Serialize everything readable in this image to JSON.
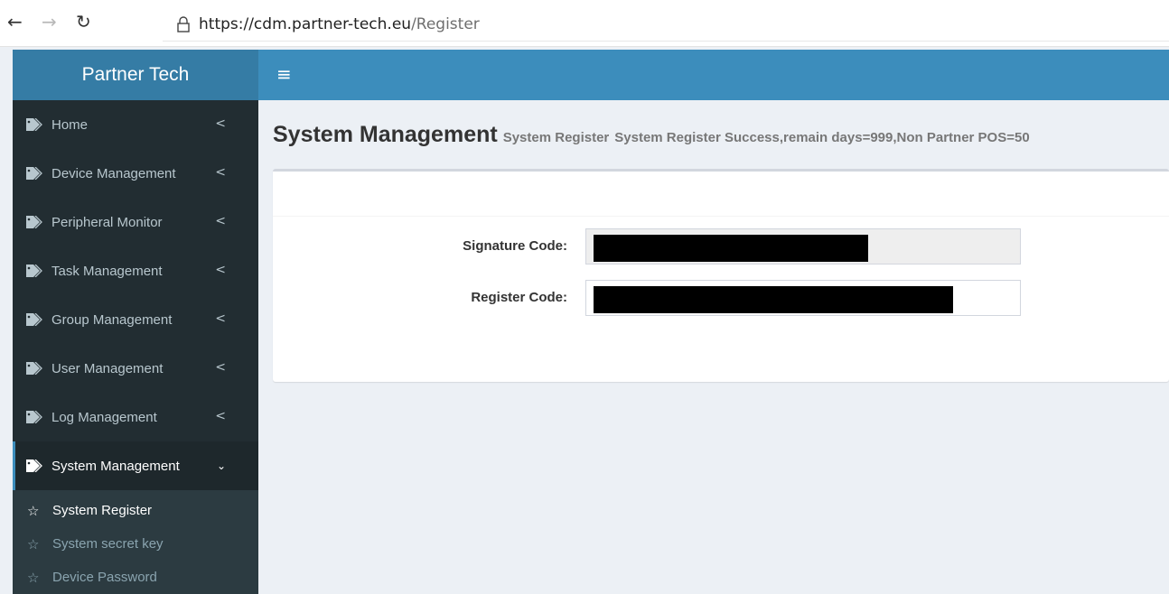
{
  "browser": {
    "url_host": "https://cdm.partner-tech.eu",
    "url_path": "/Register",
    "back_icon": "←",
    "forward_icon": "→",
    "reload_icon": "↻"
  },
  "header": {
    "logo": "Partner Tech",
    "toggle_icon": "≡"
  },
  "sidebar": {
    "items": [
      {
        "label": "Home",
        "caret": "<"
      },
      {
        "label": "Device Management",
        "caret": "<"
      },
      {
        "label": "Peripheral Monitor",
        "caret": "<"
      },
      {
        "label": "Task Management",
        "caret": "<"
      },
      {
        "label": "Group Management",
        "caret": "<"
      },
      {
        "label": "User Management",
        "caret": "<"
      },
      {
        "label": "Log Management",
        "caret": "<"
      },
      {
        "label": "System Management",
        "caret": "⌄"
      }
    ],
    "submenu": [
      {
        "label": "System Register",
        "icon": "☆"
      },
      {
        "label": "System secret key",
        "icon": "☆"
      },
      {
        "label": "Device Password",
        "icon": "☆"
      }
    ]
  },
  "content": {
    "title": "System Management",
    "subtitle": "System Register",
    "status": "System Register Success,remain days=999,Non Partner POS=50",
    "signature_label": "Signature Code:",
    "register_label": "Register Code:"
  },
  "colors": {
    "header": "#3c8dbc",
    "logo_bg": "#357ca5",
    "sidebar": "#222d32",
    "submenu": "#2c3b41"
  }
}
